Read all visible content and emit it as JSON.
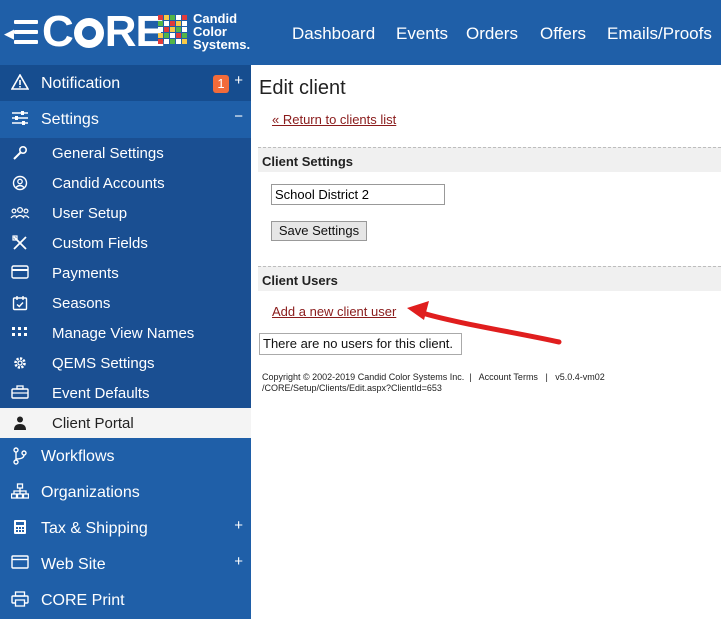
{
  "header": {
    "logo_text": "CORE",
    "brand_lines": [
      "Candid",
      "Color",
      "Systems."
    ],
    "nav": [
      "Dashboard",
      "Events",
      "Orders",
      "Offers",
      "Emails/Proofs"
    ]
  },
  "sidebar": {
    "notification": {
      "label": "Notification",
      "badge": "1",
      "plus": "+"
    },
    "settings": {
      "label": "Settings",
      "toggle": "−"
    },
    "settings_items": [
      "General Settings",
      "Candid Accounts",
      "User Setup",
      "Custom Fields",
      "Payments",
      "Seasons",
      "Manage View Names",
      "QEMS Settings",
      "Event Defaults",
      "Client Portal"
    ],
    "main_items": [
      {
        "label": "Workflows",
        "plus": ""
      },
      {
        "label": "Organizations",
        "plus": ""
      },
      {
        "label": "Tax & Shipping",
        "plus": "+"
      },
      {
        "label": "Web Site",
        "plus": "+"
      },
      {
        "label": "CORE Print",
        "plus": ""
      }
    ]
  },
  "content": {
    "title": "Edit client",
    "return_link": "« Return to clients list",
    "client_settings_header": "Client Settings",
    "client_name_value": "School District 2",
    "save_button": "Save Settings",
    "client_users_header": "Client Users",
    "add_user_link": "Add a new client user",
    "no_users_text": "There are no users for this client.",
    "footer_copyright": "Copyright © 2002-2019 Candid Color Systems Inc.",
    "footer_terms": "Account Terms",
    "footer_version": "v5.0.4-vm02",
    "footer_path": "/CORE/Setup/Clients/Edit.aspx?ClientId=653"
  },
  "colors": {
    "brand_blue": "#1f5fa8",
    "sub_blue": "#1a4f92",
    "link_red": "#8a1b1b",
    "badge_orange": "#f26b3a",
    "arrow_red": "#e01e1e"
  }
}
